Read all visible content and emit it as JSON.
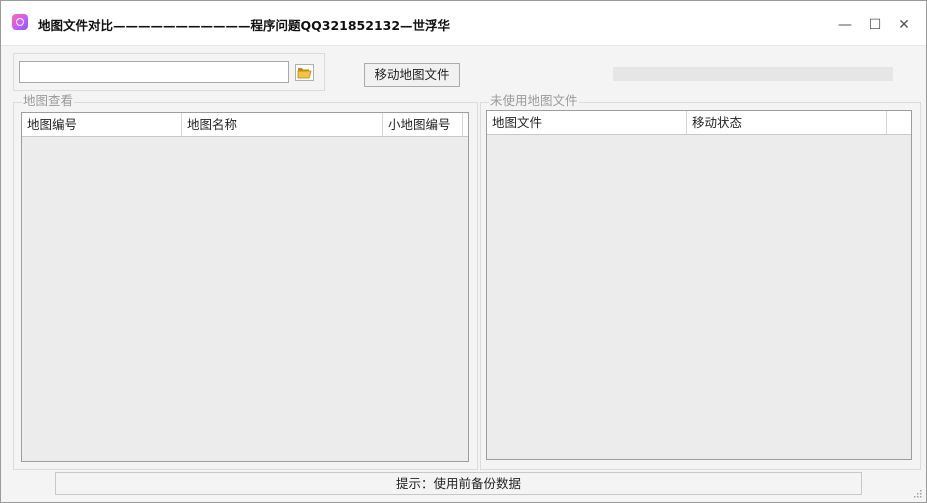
{
  "window": {
    "title": "地图文件对比———————————程序问题QQ321852132—世浮华",
    "minimize": "—",
    "maximize": "☐",
    "close": "✕"
  },
  "path_input": {
    "value": "",
    "placeholder": ""
  },
  "move_button": {
    "label": "移动地图文件"
  },
  "progress": {
    "value": 0
  },
  "left_group": {
    "label": "地图查看",
    "columns": [
      "地图编号",
      "地图名称",
      "小地图编号"
    ]
  },
  "right_group": {
    "label": "未使用地图文件",
    "columns": [
      "地图文件",
      "移动状态"
    ]
  },
  "status_text": "提示：使用前备份数据",
  "colors": {
    "accent": "#06b025",
    "border": "#9d9d9d",
    "background": "#f4f4f4"
  }
}
